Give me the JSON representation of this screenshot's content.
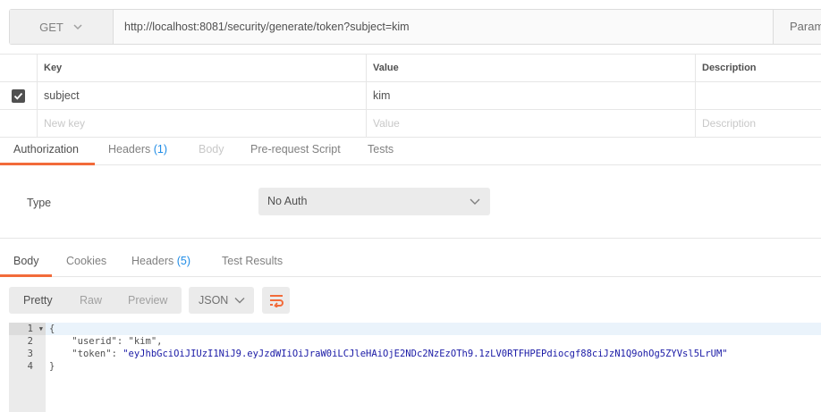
{
  "request": {
    "method": "GET",
    "url": "http://localhost:8081/security/generate/token?subject=kim",
    "params_button": "Param"
  },
  "params": {
    "columns": [
      "Key",
      "Value",
      "Description"
    ],
    "rows": [
      {
        "checked": true,
        "key": "subject",
        "value": "kim",
        "description": ""
      }
    ],
    "placeholders": {
      "key": "New key",
      "value": "Value",
      "description": "Description"
    }
  },
  "request_tabs": [
    {
      "label": "Authorization",
      "state": "active"
    },
    {
      "label": "Headers",
      "count": "(1)",
      "state": "normal"
    },
    {
      "label": "Body",
      "state": "disabled"
    },
    {
      "label": "Pre-request Script",
      "state": "normal"
    },
    {
      "label": "Tests",
      "state": "normal"
    }
  ],
  "auth": {
    "type_label": "Type",
    "type_value": "No Auth"
  },
  "response_tabs": [
    {
      "label": "Body",
      "state": "active"
    },
    {
      "label": "Cookies",
      "state": "normal"
    },
    {
      "label": "Headers",
      "count": "(5)",
      "state": "normal"
    },
    {
      "label": "Test Results",
      "state": "normal"
    }
  ],
  "response_toolbar": {
    "views": [
      "Pretty",
      "Raw",
      "Preview"
    ],
    "active_view": "Pretty",
    "format": "JSON",
    "wrap_icon": "wrap-lines-icon"
  },
  "response_body": {
    "line_numbers": [
      "1",
      "2",
      "3",
      "4"
    ],
    "lines": [
      {
        "open": "{"
      },
      {
        "key": "\"userid\"",
        "value": "\"kim\"",
        "trail": ","
      },
      {
        "key": "\"token\"",
        "value": "\"eyJhbGciOiJIUzI1NiJ9.eyJzdWIiOiJraW0iLCJleHAiOjE2NDc2NzEzOTh9.1zLV0RTFHPEPdiocgf88ciJzN1Q9ohOg5ZYVsl5LrUM\"",
        "trail": ""
      },
      {
        "close": "}"
      }
    ]
  },
  "colors": {
    "accent": "#f26b3a",
    "count": "#1f8ce6",
    "token_string": "#1a1aa6"
  }
}
